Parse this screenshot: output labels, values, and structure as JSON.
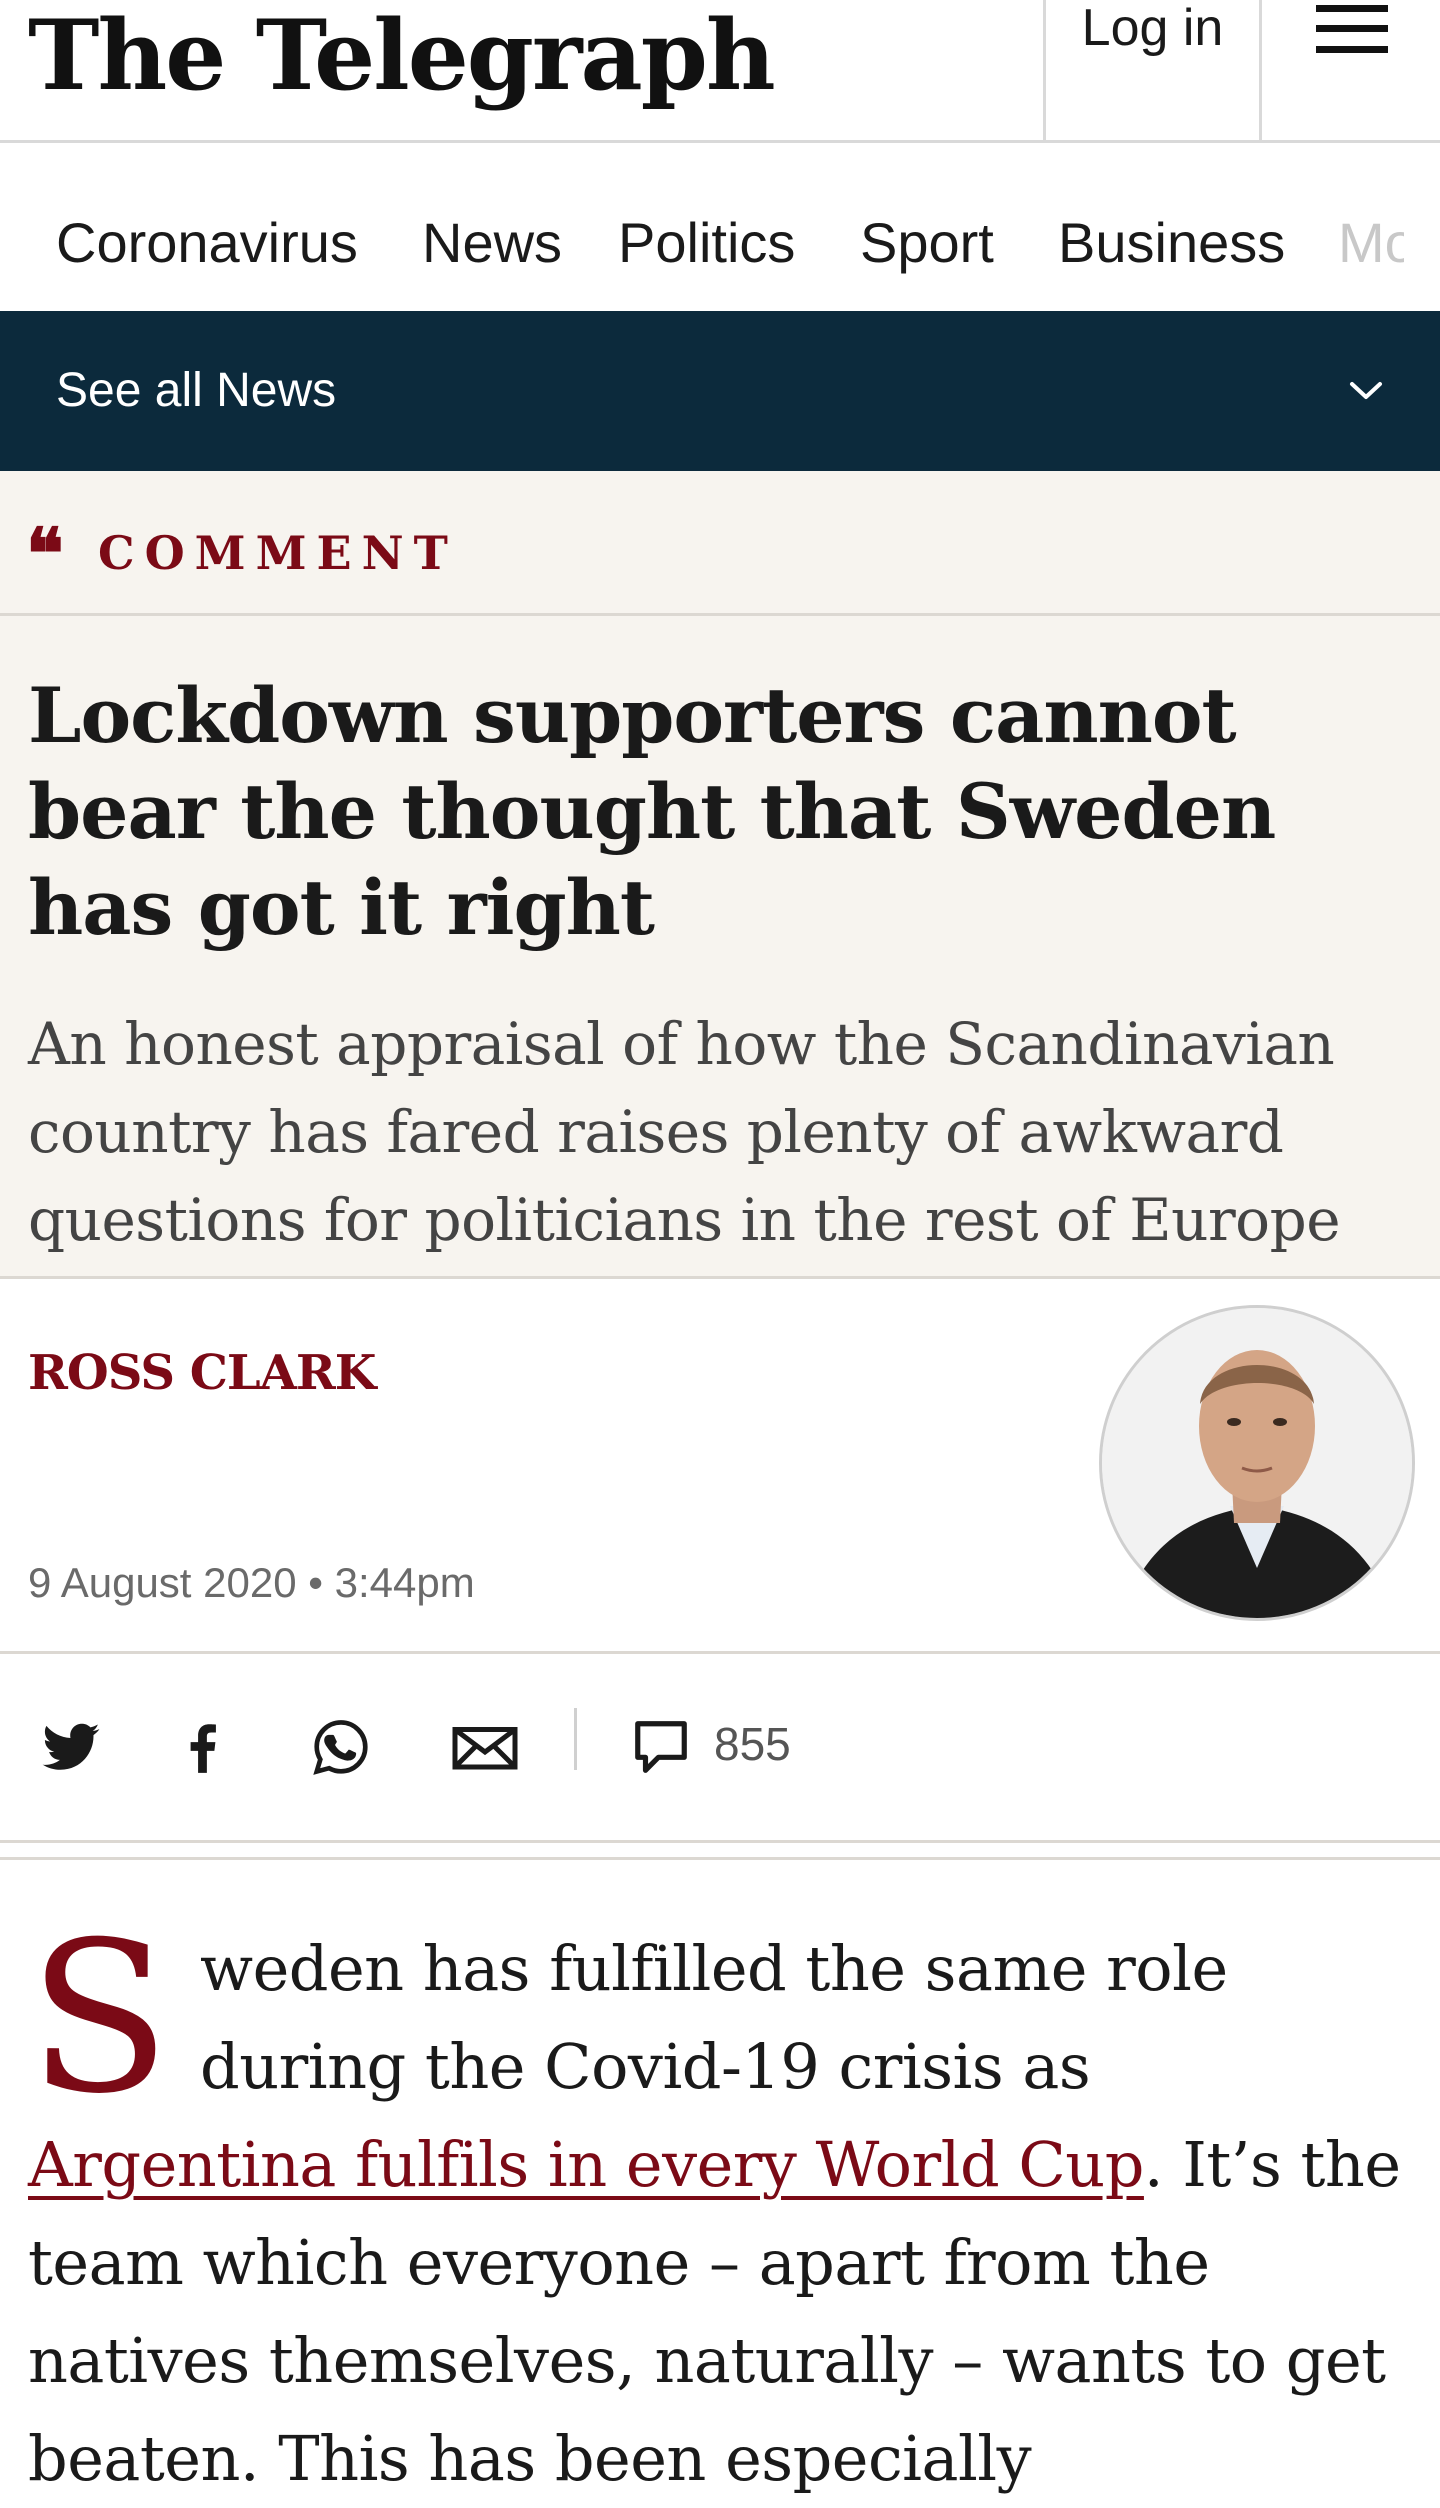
{
  "header": {
    "logo_text": "The Telegraph",
    "login_label": "Log in",
    "menu_icon": "hamburger-icon"
  },
  "nav": {
    "tabs": [
      {
        "label": "Coronavirus",
        "active": false
      },
      {
        "label": "News",
        "active": true
      },
      {
        "label": "Politics",
        "active": false
      },
      {
        "label": "Sport",
        "active": false
      },
      {
        "label": "Business",
        "active": false
      },
      {
        "label": "Mo",
        "active": false
      }
    ],
    "accent_color": "#158f85"
  },
  "subnav": {
    "label": "See all News",
    "icon": "chevron-down-icon",
    "background": "#0c2a3c"
  },
  "article": {
    "section_label": "COMMENT",
    "section_icon": "quote-icon",
    "headline": "Lockdown supporters cannot bear the thought that Sweden has got it right",
    "standfirst": "An honest appraisal of how the Scandinavian country has fared raises plenty of awkward questions for politicians in the rest of Europe",
    "author": "ROSS CLARK",
    "date": "9 August 2020 • 3:44pm",
    "comment_count": "855",
    "share_icons": [
      "twitter-icon",
      "facebook-icon",
      "whatsapp-icon",
      "email-icon"
    ],
    "brand_color": "#7b0a16",
    "body": {
      "drop_cap": "S",
      "text_1": "weden has fulfilled the same role during the Covid-19 crisis as ",
      "link_text": "Argentina fulfils in every World Cup",
      "text_2": ". It’s the team which everyone – apart from the natives themselves, naturally – wants to get beaten. This has been especially"
    }
  }
}
